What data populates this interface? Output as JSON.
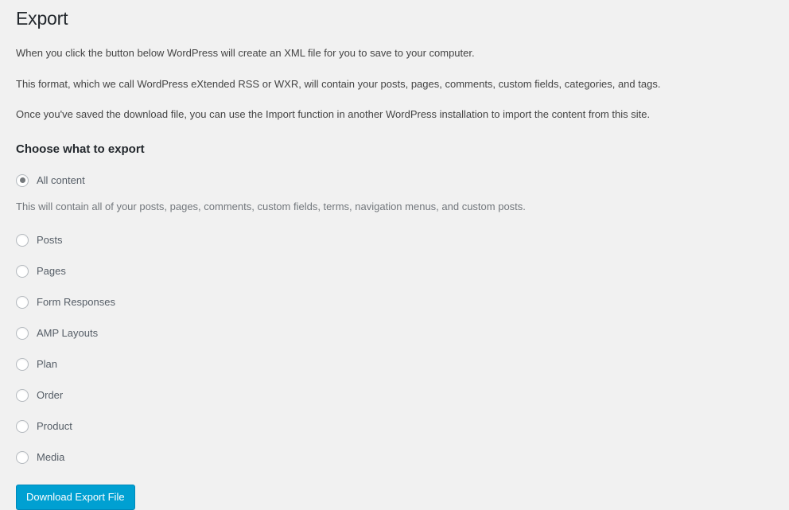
{
  "page": {
    "title": "Export",
    "background_color": "#f1f1f1"
  },
  "intro": {
    "paragraph_1": "When you click the button below WordPress will create an XML file for you to save to your computer.",
    "paragraph_2": "This format, which we call WordPress eXtended RSS or WXR, will contain your posts, pages, comments, custom fields, categories, and tags.",
    "paragraph_3": "Once you've saved the download file, you can use the Import function in another WordPress installation to import the content from this site."
  },
  "export_options": {
    "heading": "Choose what to export",
    "all_content": {
      "label": "All content",
      "selected": true,
      "description": "This will contain all of your posts, pages, comments, custom fields, terms, navigation menus, and custom posts."
    },
    "items": [
      {
        "label": "Posts",
        "selected": false
      },
      {
        "label": "Pages",
        "selected": false
      },
      {
        "label": "Form Responses",
        "selected": false
      },
      {
        "label": "AMP Layouts",
        "selected": false
      },
      {
        "label": "Plan",
        "selected": false
      },
      {
        "label": "Order",
        "selected": false
      },
      {
        "label": "Product",
        "selected": false
      },
      {
        "label": "Media",
        "selected": false
      }
    ]
  },
  "submit": {
    "label": "Download Export File",
    "accent_color": "#00a0d2"
  }
}
